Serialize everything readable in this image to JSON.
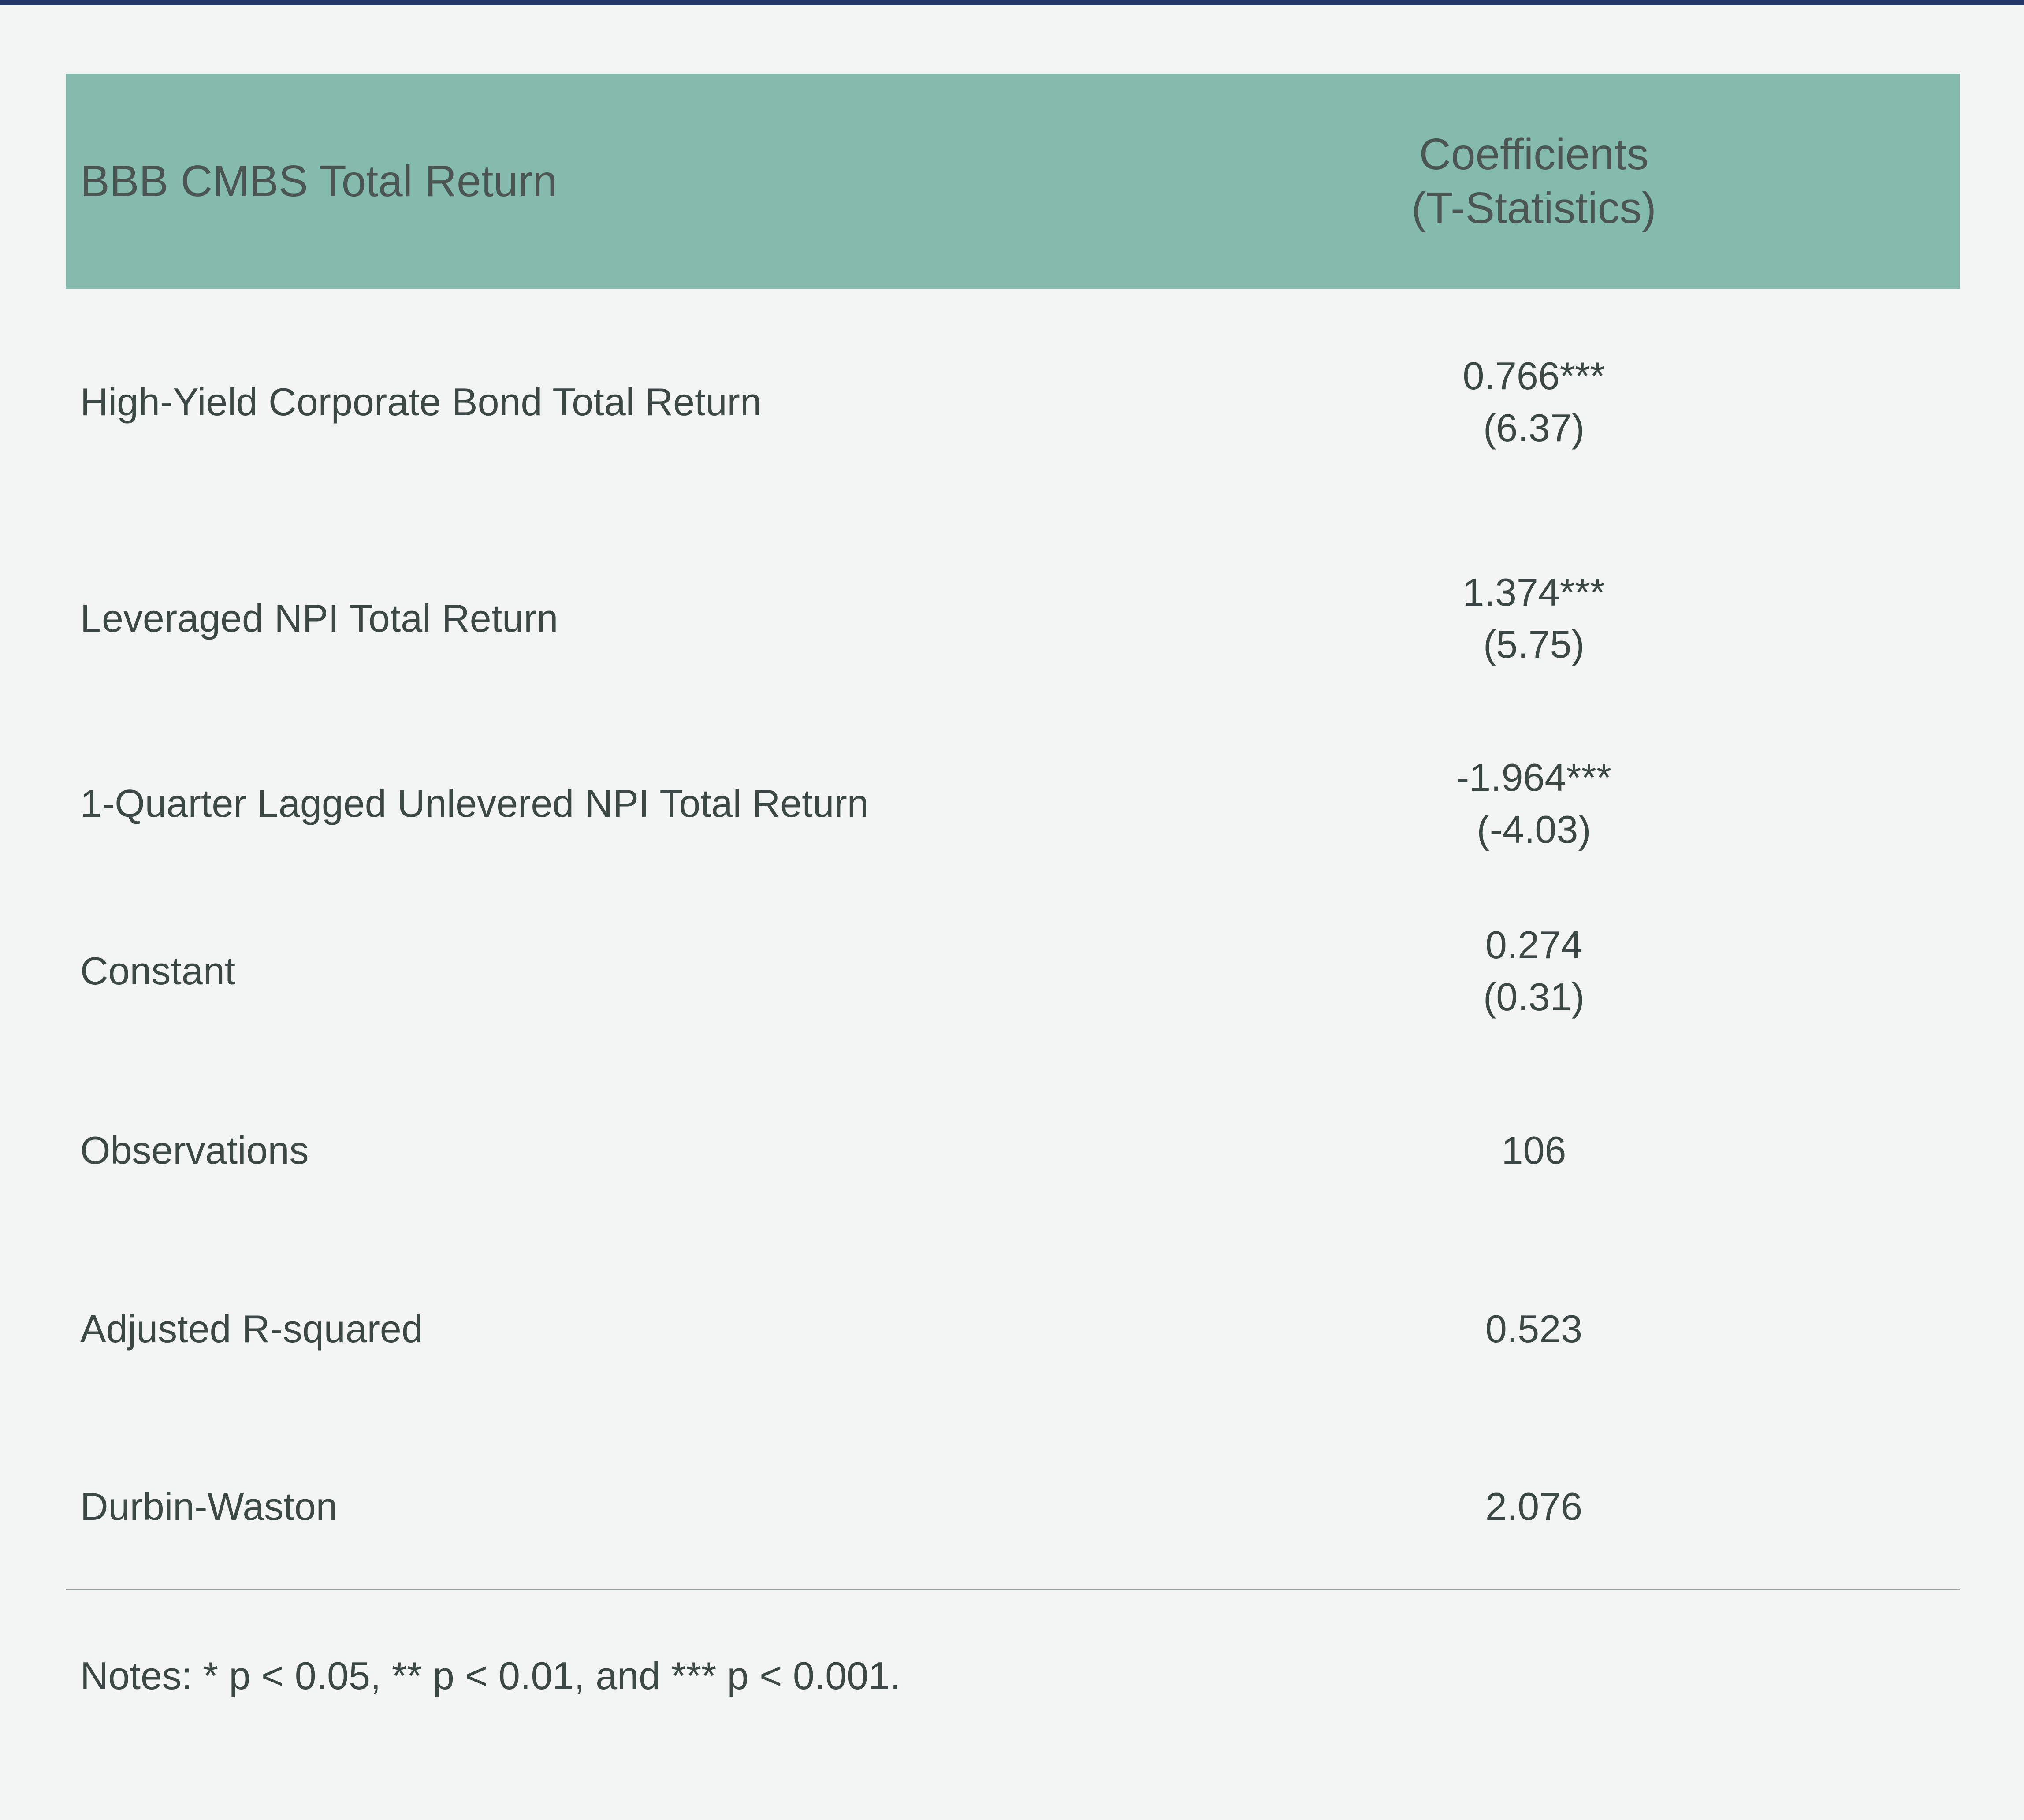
{
  "header": {
    "column_label": "BBB CMBS Total Return",
    "value_line1": "Coefficients",
    "value_line2": "(T-Statistics)"
  },
  "rows": [
    {
      "label": "High-Yield Corporate Bond Total Return",
      "coef": "0.766***",
      "tstat": "(6.37)"
    },
    {
      "label": "Leveraged NPI Total Return",
      "coef": "1.374***",
      "tstat": "(5.75)"
    },
    {
      "label": "1-Quarter Lagged Unlevered NPI Total Return",
      "coef": "-1.964***",
      "tstat": "(-4.03)"
    },
    {
      "label": "Constant",
      "coef": "0.274",
      "tstat": "(0.31)"
    },
    {
      "label": "Observations",
      "coef": "106"
    },
    {
      "label": "Adjusted R-squared",
      "coef": "0.523"
    },
    {
      "label": "Durbin-Waston",
      "coef": "2.076"
    }
  ],
  "notes": "Notes: * p < 0.05, ** p < 0.01, and *** p < 0.001.",
  "colors": {
    "top_rule": "#22386b",
    "header_fill": "#84bbad",
    "page_background": "#f3f5f4",
    "text": "#3c4845"
  }
}
